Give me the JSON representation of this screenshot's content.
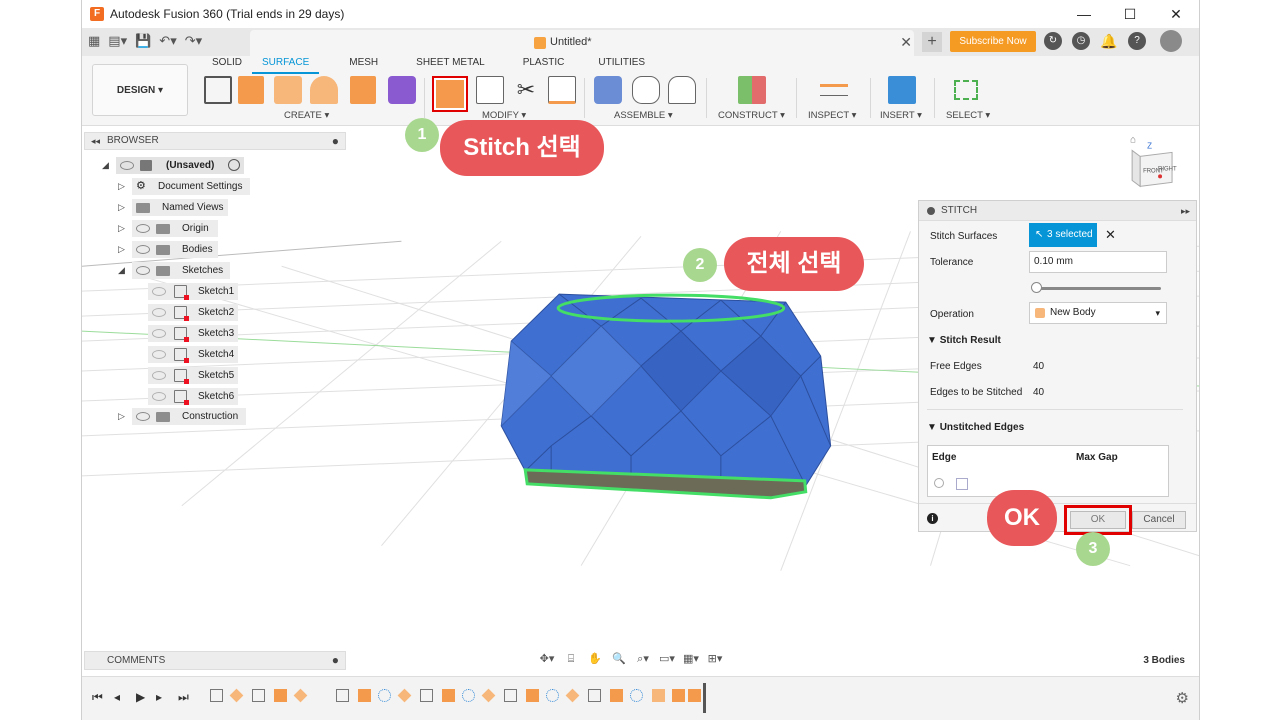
{
  "window": {
    "title": "Autodesk Fusion 360 (Trial ends in 29 days)",
    "controls": [
      "—",
      "☐",
      "✕"
    ]
  },
  "document_tab": {
    "label": "Untitled*"
  },
  "subscribe_label": "Subscribe Now",
  "design_button": "DESIGN ▾",
  "workspace_tabs": [
    "SOLID",
    "SURFACE",
    "MESH",
    "SHEET METAL",
    "PLASTIC",
    "UTILITIES"
  ],
  "active_tab": "SURFACE",
  "tool_groups": {
    "create": "CREATE ▾",
    "modify": "MODIFY ▾",
    "assemble": "ASSEMBLE ▾",
    "construct": "CONSTRUCT ▾",
    "inspect": "INSPECT ▾",
    "insert": "INSERT ▾",
    "select": "SELECT ▾"
  },
  "browser": {
    "title": "BROWSER",
    "root": "(Unsaved)",
    "items": [
      "Document Settings",
      "Named Views",
      "Origin",
      "Bodies",
      "Sketches"
    ],
    "sketches": [
      "Sketch1",
      "Sketch2",
      "Sketch3",
      "Sketch4",
      "Sketch5",
      "Sketch6"
    ],
    "construction": "Construction"
  },
  "stitch_panel": {
    "title": "STITCH",
    "stitch_surfaces_label": "Stitch Surfaces",
    "selected": "3 selected",
    "tolerance_label": "Tolerance",
    "tolerance_value": "0.10 mm",
    "operation_label": "Operation",
    "operation_value": "New Body",
    "stitch_result": "Stitch Result",
    "free_edges_label": "Free Edges",
    "free_edges_value": "40",
    "to_stitch_label": "Edges to be Stitched",
    "to_stitch_value": "40",
    "unstitched_edges": "Unstitched Edges",
    "edge_col": "Edge",
    "max_gap_col": "Max Gap",
    "ok": "OK",
    "cancel": "Cancel"
  },
  "annotations": {
    "step1_num": "1",
    "step1_text": "Stitch 선택",
    "step2_num": "2",
    "step2_text": "전체 선택",
    "step3_num": "3",
    "ok_text": "OK"
  },
  "comments_label": "COMMENTS",
  "bodies_count": "3 Bodies",
  "viewcube": {
    "front": "FRONT",
    "right": "RIGHT",
    "axis": "Z"
  },
  "colors": {
    "accent": "#0696d7",
    "highlight": "#e10000",
    "callout": "#e8575a",
    "step": "#a8d88f",
    "body": "#3f6fd0"
  }
}
